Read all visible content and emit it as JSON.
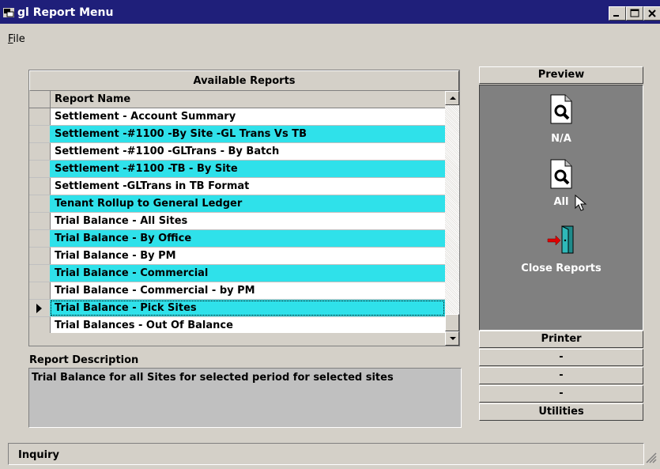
{
  "window": {
    "title": "gl Report Menu"
  },
  "menu": {
    "file": "File"
  },
  "grid": {
    "caption": "Available Reports",
    "column_header": "Report Name",
    "rows": [
      "Settlement - Account Summary",
      "Settlement -#1100 -By Site -GL Trans Vs TB",
      "Settlement -#1100 -GLTrans - By Batch",
      "Settlement -#1100 -TB - By Site",
      "Settlement -GLTrans in TB Format",
      "Tenant Rollup to General Ledger",
      "Trial Balance - All Sites",
      "Trial Balance - By Office",
      "Trial Balance - By PM",
      "Trial Balance - Commercial",
      "Trial Balance - Commercial - by PM",
      "Trial Balance - Pick Sites",
      "Trial Balances - Out Of Balance"
    ],
    "selected_row": "Trial Balance - Pick Sites",
    "alt_row_color": "#2fe1ea"
  },
  "description": {
    "label": "Report Description",
    "text": "Trial Balance for all Sites for selected period for selected sites"
  },
  "side": {
    "preview": "Preview",
    "na": "N/A",
    "all": "All",
    "close_reports": "Close Reports",
    "printer": "Printer",
    "blank1": "-",
    "blank2": "-",
    "blank3": "-",
    "utilities": "Utilities"
  },
  "status": {
    "text": "Inquiry"
  }
}
